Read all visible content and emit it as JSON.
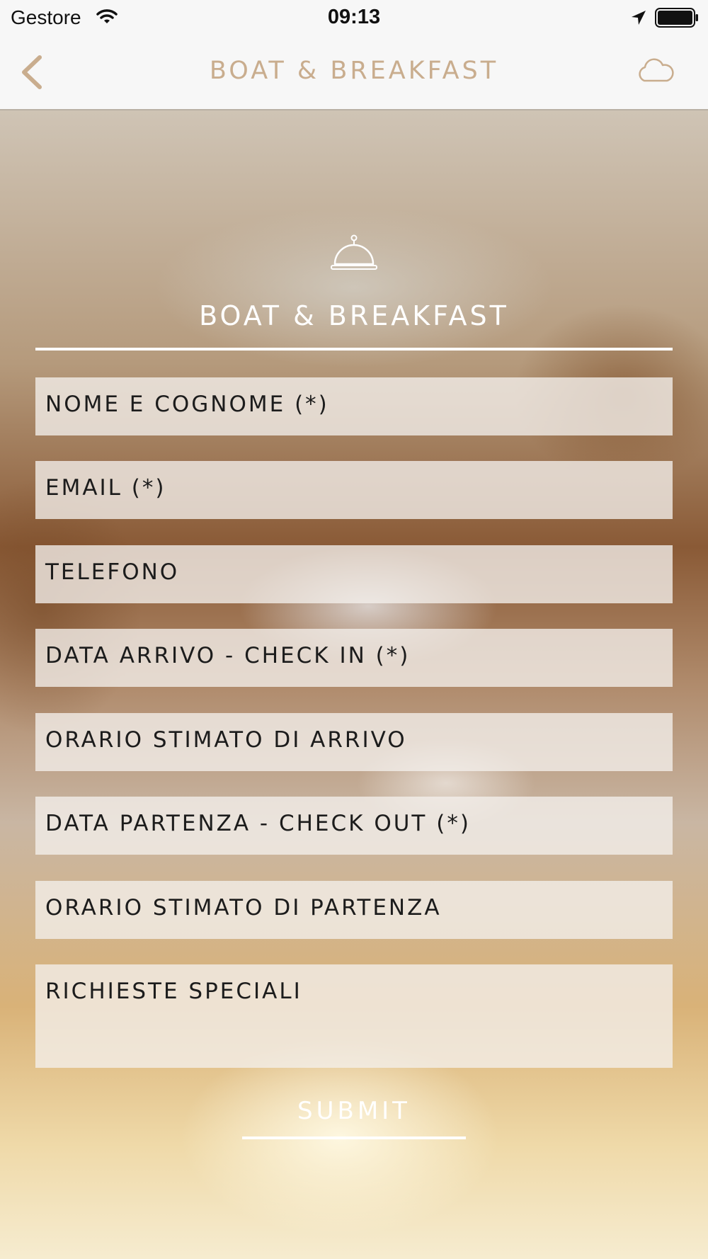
{
  "status_bar": {
    "carrier": "Gestore",
    "time": "09:13",
    "wifi_icon": "wifi-icon",
    "location_icon": "location-arrow-icon",
    "battery_icon": "battery-icon"
  },
  "nav": {
    "title": "BOAT & BREAKFAST",
    "back_icon": "chevron-left-icon",
    "cloud_icon": "cloud-icon",
    "accent_color": "#c9ad8e"
  },
  "form": {
    "icon": "room-service-bell-icon",
    "title": "BOAT & BREAKFAST",
    "fields": [
      {
        "name": "full-name-field",
        "placeholder": "NOME E COGNOME (*)"
      },
      {
        "name": "email-field",
        "placeholder": "EMAIL (*)"
      },
      {
        "name": "phone-field",
        "placeholder": "TELEFONO"
      },
      {
        "name": "check-in-date-field",
        "placeholder": "DATA ARRIVO - CHECK IN (*)"
      },
      {
        "name": "arrival-time-field",
        "placeholder": "ORARIO STIMATO DI ARRIVO"
      },
      {
        "name": "check-out-date-field",
        "placeholder": "DATA PARTENZA - CHECK OUT (*)"
      },
      {
        "name": "departure-time-field",
        "placeholder": "ORARIO STIMATO DI PARTENZA"
      },
      {
        "name": "special-requests-field",
        "placeholder": "RICHIESTE SPECIALI"
      }
    ],
    "submit_label": "SUBMIT"
  }
}
